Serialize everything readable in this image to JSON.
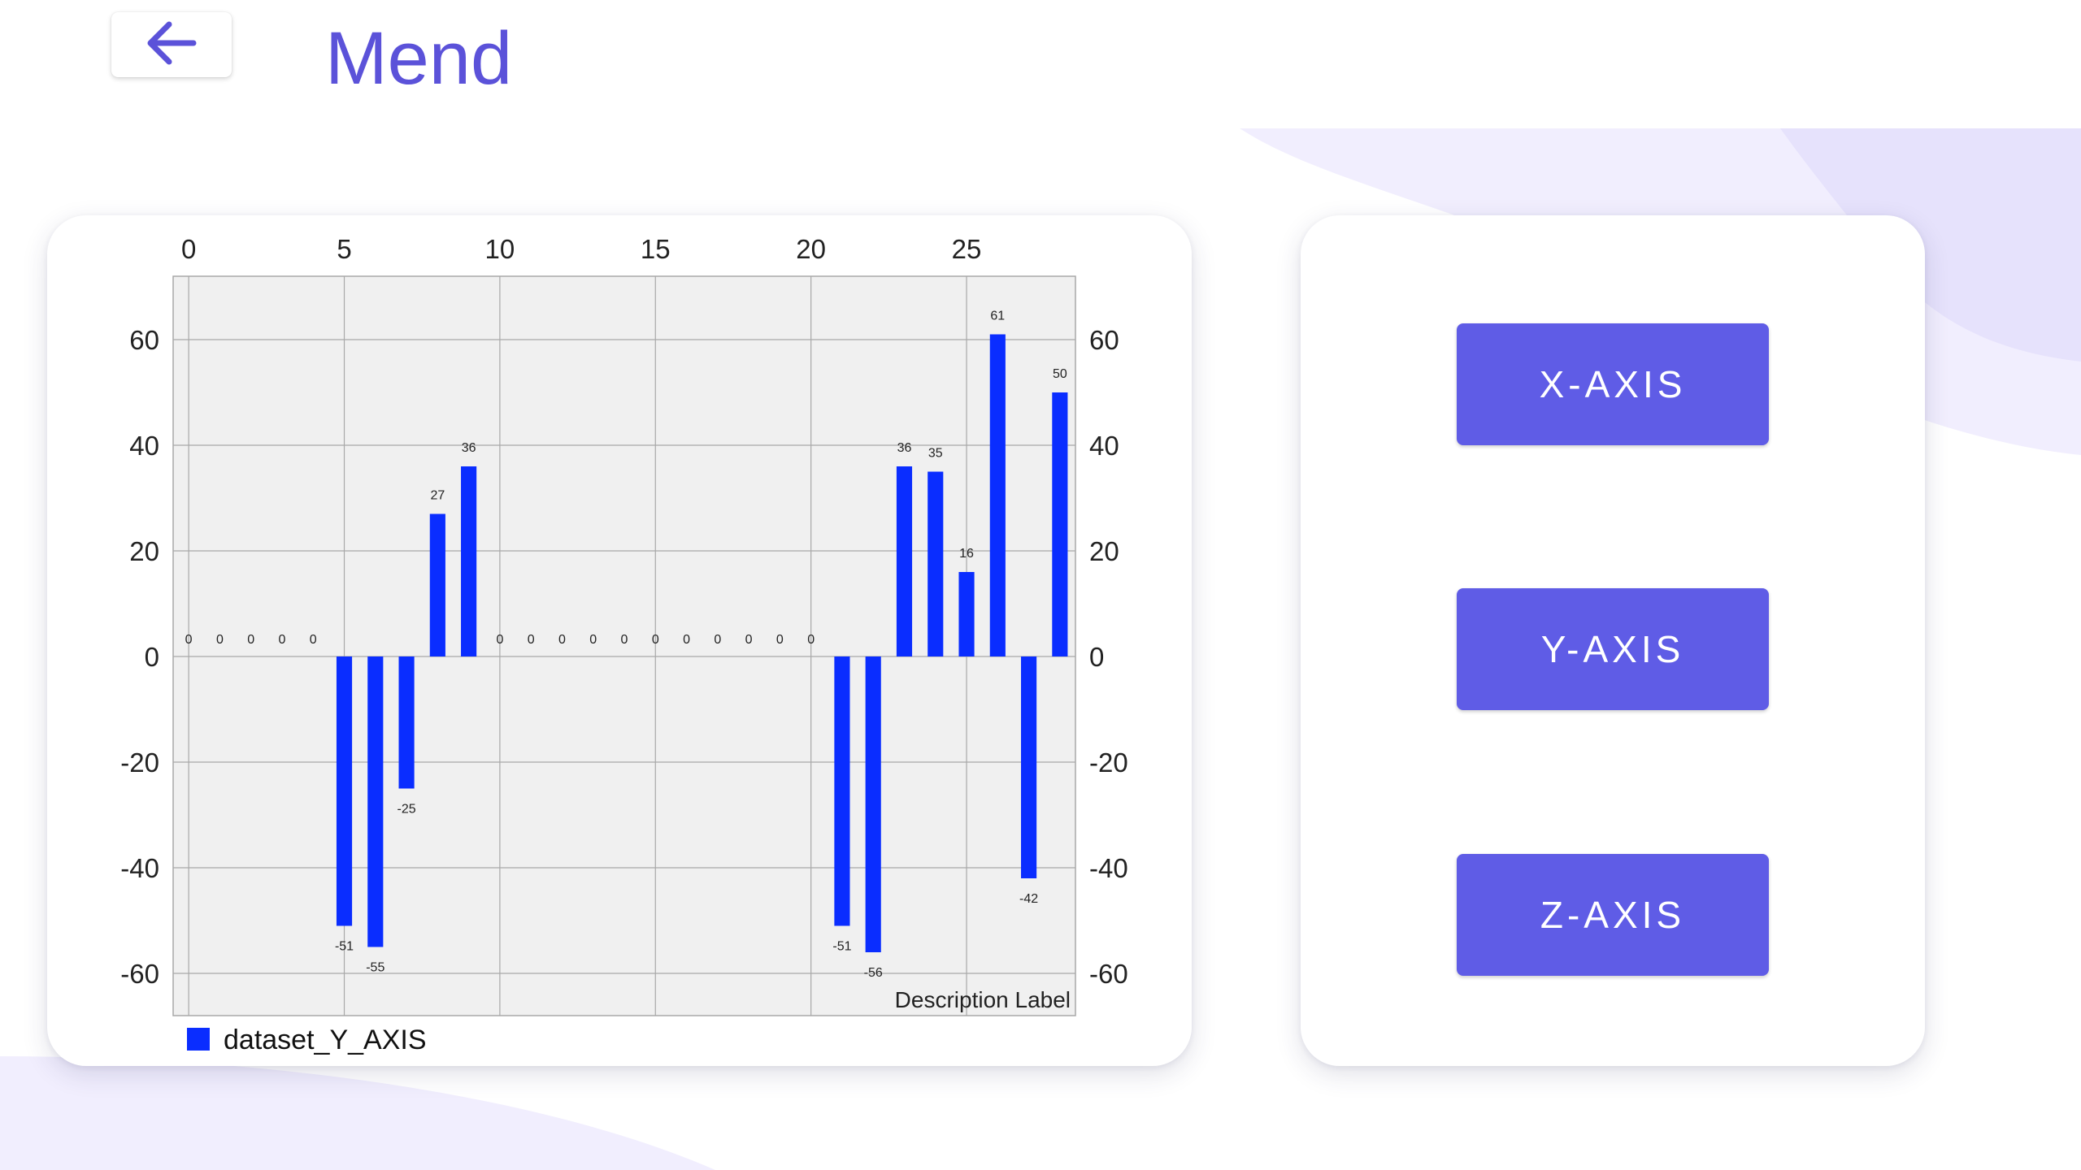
{
  "app": {
    "title": "Mend"
  },
  "colors": {
    "accent": "#5b52d9",
    "button": "#5f5ce6",
    "bar": "#0a2dff",
    "plot_bg": "#f0f0f0"
  },
  "icons": {
    "back": "arrow-left-icon"
  },
  "buttons": [
    {
      "label": "X-AXIS"
    },
    {
      "label": "Y-AXIS"
    },
    {
      "label": "Z-AXIS"
    }
  ],
  "chart_data": {
    "type": "bar",
    "x": [
      0,
      1,
      2,
      3,
      4,
      5,
      6,
      7,
      8,
      9,
      10,
      11,
      12,
      13,
      14,
      15,
      16,
      17,
      18,
      19,
      20,
      21,
      22,
      23,
      24,
      25,
      26,
      27,
      28
    ],
    "series": [
      {
        "name": "dataset_Y_AXIS",
        "values": [
          0,
          0,
          0,
          0,
          0,
          -51,
          -55,
          -25,
          27,
          36,
          0,
          0,
          0,
          0,
          0,
          0,
          0,
          0,
          0,
          0,
          0,
          -51,
          -56,
          36,
          35,
          16,
          61,
          -42,
          50
        ]
      }
    ],
    "x_ticks": [
      "0",
      "5",
      "10",
      "15",
      "20",
      "25"
    ],
    "y_ticks": [
      "60",
      "40",
      "20",
      "0",
      "-20",
      "-40",
      "-60"
    ],
    "xlim": [
      -0.5,
      28.5
    ],
    "ylim": [
      -68,
      72
    ],
    "x_axis_position": "top",
    "y_axes": "both",
    "grid": true,
    "legend_position": "bottom-left",
    "description": "Description Label"
  }
}
